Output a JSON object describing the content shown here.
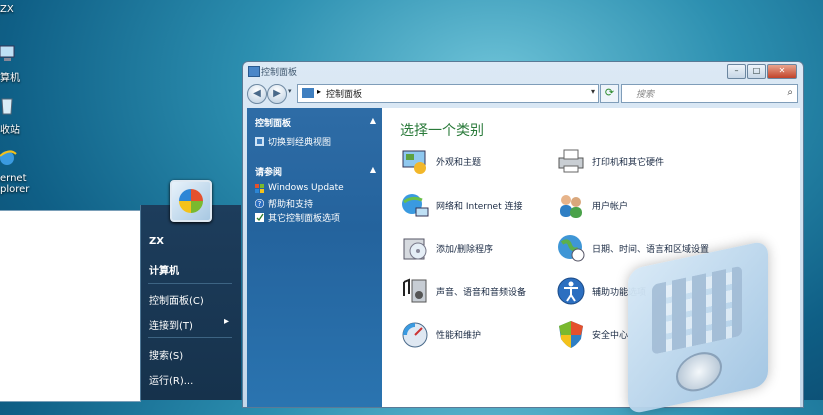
{
  "desktop": {
    "icons": [
      {
        "name": "user-folder",
        "label": "ZX"
      },
      {
        "name": "computer",
        "label": "算机"
      },
      {
        "name": "recycle-bin",
        "label": "收站"
      },
      {
        "name": "internet-explorer",
        "label": "ernet\nplorer"
      }
    ]
  },
  "start_menu": {
    "user": "ZX",
    "items": [
      "计算机",
      "控制面板(C)",
      "连接到(T)",
      "搜索(S)",
      "运行(R)..."
    ],
    "submenu_arrow": "▸"
  },
  "window": {
    "title": "控制面板",
    "address": "控制面板",
    "search_placeholder": "搜索",
    "left_pane": {
      "header": "控制面板",
      "classic_view": "切换到经典视图",
      "see_also_header": "请参阅",
      "links": [
        "Windows Update",
        "帮助和支持",
        "其它控制面板选项"
      ]
    },
    "main": {
      "title": "选择一个类别",
      "categories": [
        {
          "label": "外观和主题",
          "icon": "appearance-icon"
        },
        {
          "label": "打印机和其它硬件",
          "icon": "printer-icon"
        },
        {
          "label": "网络和 Internet 连接",
          "icon": "network-icon"
        },
        {
          "label": "用户帐户",
          "icon": "users-icon"
        },
        {
          "label": "添加/删除程序",
          "icon": "programs-icon"
        },
        {
          "label": "日期、时间、语言和区域设置",
          "icon": "globe-icon"
        },
        {
          "label": "声音、语音和音频设备",
          "icon": "sound-icon"
        },
        {
          "label": "辅助功能选项",
          "icon": "accessibility-icon"
        },
        {
          "label": "性能和维护",
          "icon": "performance-icon"
        },
        {
          "label": "安全中心",
          "icon": "shield-icon"
        }
      ]
    }
  }
}
